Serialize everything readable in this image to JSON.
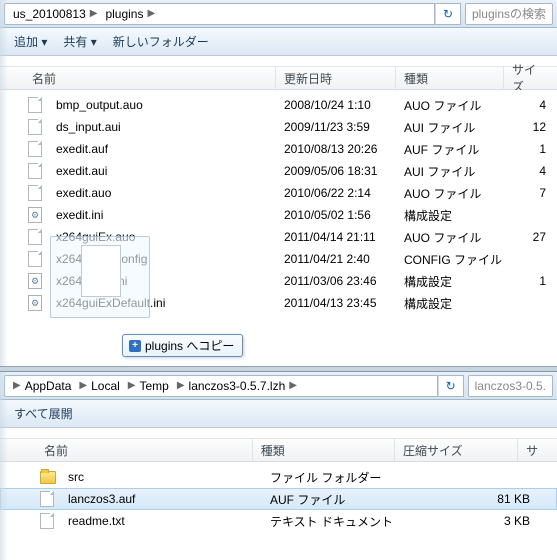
{
  "top": {
    "path": [
      "us_20100813",
      "plugins"
    ],
    "search_label": "pluginsの検索",
    "toolbar": {
      "add": "追加 ▾",
      "share": "共有 ▾",
      "newfolder": "新しいフォルダー"
    },
    "cols": {
      "name": "名前",
      "date": "更新日時",
      "type": "種類",
      "size": "サイズ"
    },
    "rows": [
      {
        "i": "f",
        "name": "bmp_output.auo",
        "date": "2008/10/24 1:10",
        "type": "AUO ファイル",
        "size": "4"
      },
      {
        "i": "f",
        "name": "ds_input.aui",
        "date": "2009/11/23 3:59",
        "type": "AUI ファイル",
        "size": "12"
      },
      {
        "i": "f",
        "name": "exedit.auf",
        "date": "2010/08/13 20:26",
        "type": "AUF ファイル",
        "size": "1"
      },
      {
        "i": "f",
        "name": "exedit.aui",
        "date": "2009/05/06 18:31",
        "type": "AUI ファイル",
        "size": "4"
      },
      {
        "i": "f",
        "name": "exedit.auo",
        "date": "2010/06/22 2:14",
        "type": "AUO ファイル",
        "size": "7"
      },
      {
        "i": "ini",
        "name": "exedit.ini",
        "date": "2010/05/02 1:56",
        "type": "構成設定",
        "size": ""
      },
      {
        "i": "f",
        "name": "x264guiEx.auo",
        "date": "2011/04/14 21:11",
        "type": "AUO ファイル",
        "size": "27"
      },
      {
        "i": "f",
        "name": "x264guiEx.config",
        "date": "2011/04/21 2:40",
        "type": "CONFIG ファイル",
        "size": ""
      },
      {
        "i": "ini",
        "name": "x264guiEx.ini",
        "date": "2011/03/06 23:46",
        "type": "構成設定",
        "size": "1"
      },
      {
        "i": "ini",
        "name": "x264guiExDefault.ini",
        "date": "2011/04/13 23:45",
        "type": "構成設定",
        "size": ""
      }
    ],
    "copy_tip": "plugins へコピー"
  },
  "bottom": {
    "path": [
      "AppData",
      "Local",
      "Temp",
      "lanczos3-0.5.7.lzh"
    ],
    "search_label": "lanczos3-0.5.",
    "toolbar": {
      "extract": "すべて展開"
    },
    "cols": {
      "name": "名前",
      "type": "種類",
      "csize": "圧縮サイズ",
      "attr": "サ"
    },
    "rows": [
      {
        "i": "d",
        "name": "src",
        "type": "ファイル フォルダー",
        "csize": "",
        "sel": false
      },
      {
        "i": "f",
        "name": "lanczos3.auf",
        "type": "AUF ファイル",
        "csize": "81 KB",
        "sel": true
      },
      {
        "i": "f",
        "name": "readme.txt",
        "type": "テキスト ドキュメント",
        "csize": "3 KB",
        "sel": false
      }
    ]
  }
}
